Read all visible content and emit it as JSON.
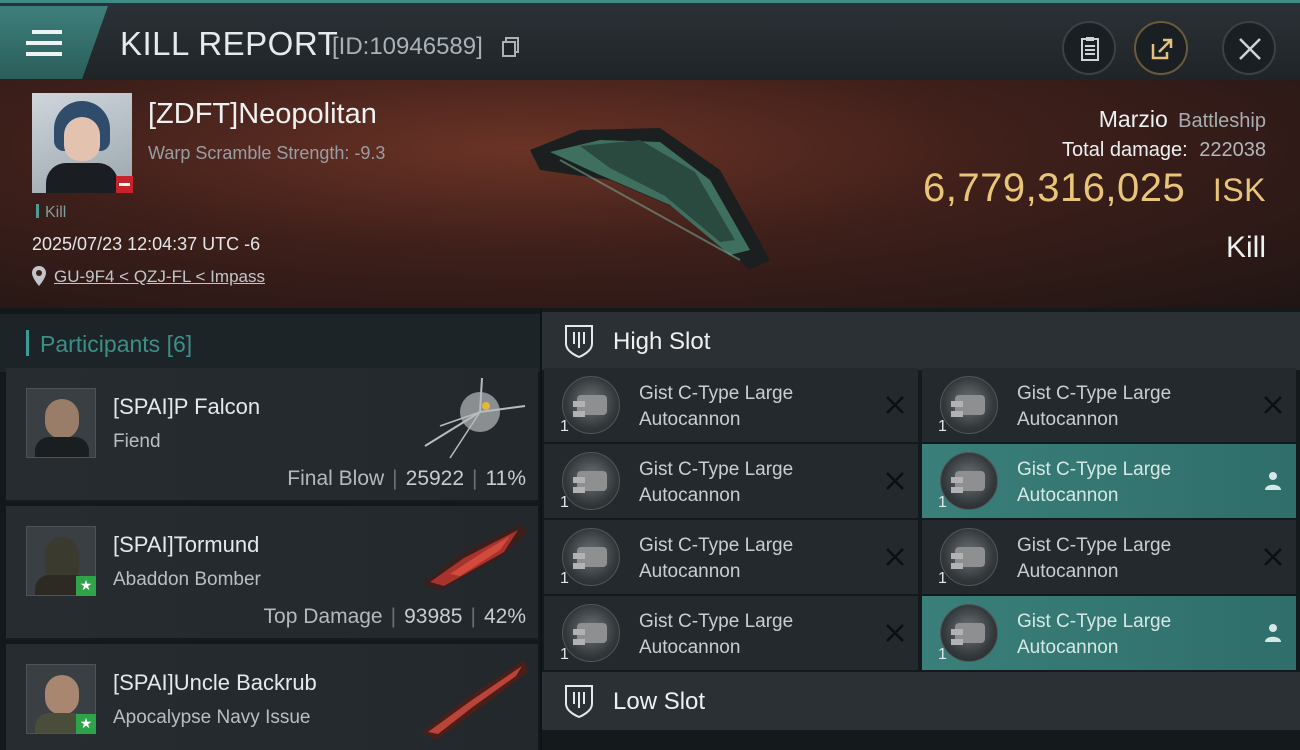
{
  "header": {
    "title": "KILL REPORT",
    "report_id": "[ID:10946589]",
    "buttons": {
      "menu": "menu-icon",
      "clipboard": "clipboard-icon",
      "share": "share-icon",
      "close": "close-icon"
    }
  },
  "victim": {
    "name": "[ZDFT]Neopolitan",
    "subtitle": "Warp Scramble Strength: -9.3",
    "kill_tag": "Kill",
    "timestamp": "2025/07/23 12:04:37 UTC -6",
    "location": "GU-9F4 < QZJ-FL < Impass",
    "ship_name": "Marzio",
    "ship_class": "Battleship",
    "total_damage_label": "Total damage:",
    "total_damage": "222038",
    "isk_value": "6,779,316,025",
    "isk_unit": "ISK",
    "result": "Kill"
  },
  "participants": {
    "title": "Participants",
    "count": "[6]",
    "rows": [
      {
        "name": "[SPAI]P Falcon",
        "ship": "Fiend",
        "stat_label": "Final Blow",
        "damage": "25922",
        "percent": "11%"
      },
      {
        "name": "[SPAI]Tormund",
        "ship": "Abaddon Bomber",
        "stat_label": "Top Damage",
        "damage": "93985",
        "percent": "42%"
      },
      {
        "name": "[SPAI]Uncle Backrub",
        "ship": "Apocalypse Navy Issue",
        "stat_label": "",
        "damage": "",
        "percent": ""
      }
    ]
  },
  "slots": {
    "high_slot_label": "High Slot",
    "low_slot_label": "Low Slot",
    "high_modules": [
      {
        "line1": "Gist C-Type Large",
        "line2": "Autocannon",
        "qty": "1",
        "status": "destroyed"
      },
      {
        "line1": "Gist C-Type Large",
        "line2": "Autocannon",
        "qty": "1",
        "status": "destroyed"
      },
      {
        "line1": "Gist C-Type Large",
        "line2": "Autocannon",
        "qty": "1",
        "status": "destroyed"
      },
      {
        "line1": "Gist C-Type Large",
        "line2": "Autocannon",
        "qty": "1",
        "status": "dropped"
      },
      {
        "line1": "Gist C-Type Large",
        "line2": "Autocannon",
        "qty": "1",
        "status": "destroyed"
      },
      {
        "line1": "Gist C-Type Large",
        "line2": "Autocannon",
        "qty": "1",
        "status": "destroyed"
      },
      {
        "line1": "Gist C-Type Large",
        "line2": "Autocannon",
        "qty": "1",
        "status": "destroyed"
      },
      {
        "line1": "Gist C-Type Large",
        "line2": "Autocannon",
        "qty": "1",
        "status": "dropped"
      }
    ]
  },
  "colors": {
    "accent_teal": "#3e9c96",
    "isk_gold": "#e9c57a",
    "dropped_highlight": "#3a7f7a",
    "badge_red": "#c8232a",
    "badge_green": "#2fa34a"
  }
}
